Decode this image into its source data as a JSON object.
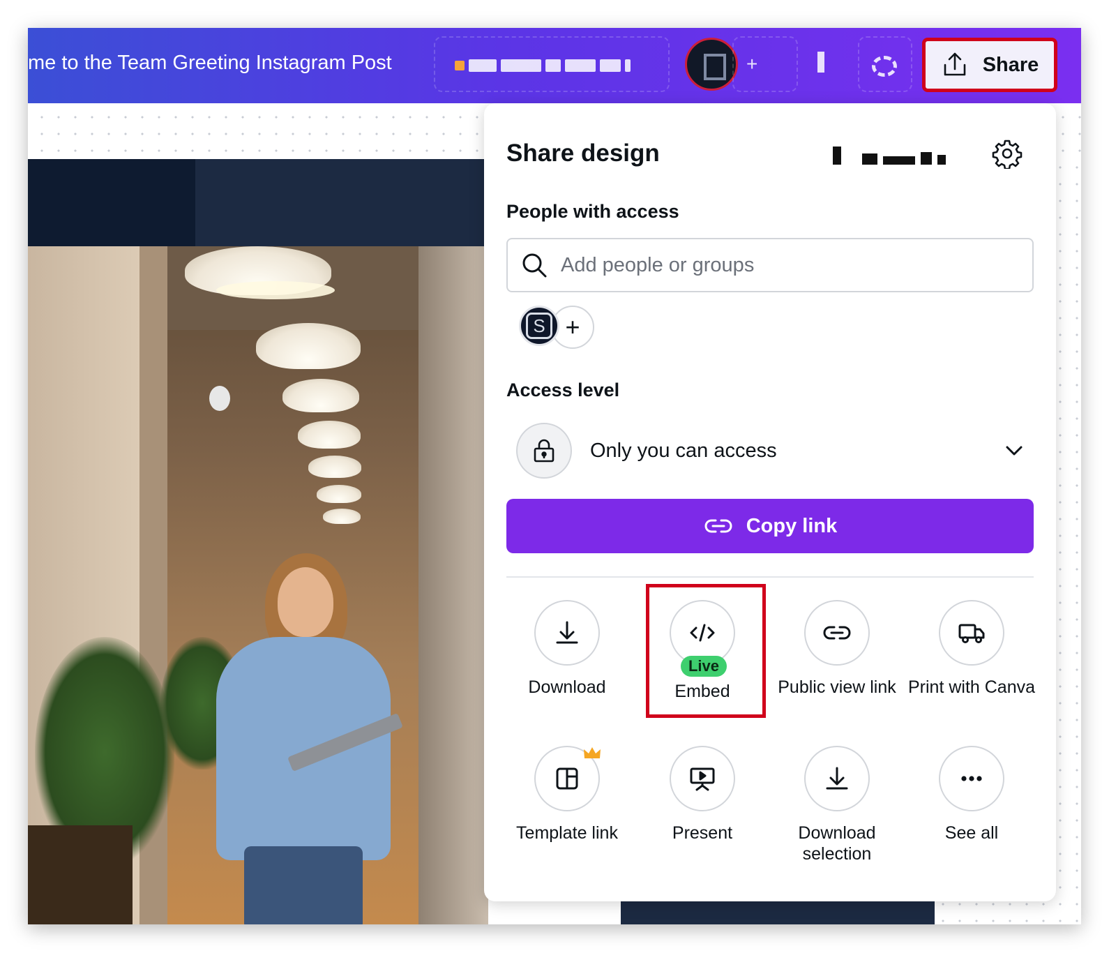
{
  "topbar": {
    "doc_title": "me to the Team Greeting Instagram Post",
    "share_label": "Share"
  },
  "share_panel": {
    "title": "Share design",
    "people_section_label": "People with access",
    "search_placeholder": "Add people or groups",
    "member_initial": "S",
    "add_member_label": "+",
    "access_section_label": "Access level",
    "access_value": "Only you can access",
    "copy_link_label": "Copy link",
    "options": [
      {
        "label": "Download",
        "icon": "download-icon"
      },
      {
        "label": "Embed",
        "icon": "embed-code-icon",
        "badge": "Live"
      },
      {
        "label": "Public view link",
        "icon": "link-icon"
      },
      {
        "label": "Print with Canva",
        "icon": "truck-icon"
      },
      {
        "label": "Template link",
        "icon": "template-icon",
        "premium": true
      },
      {
        "label": "Present",
        "icon": "present-icon"
      },
      {
        "label": "Download selection",
        "icon": "download-icon"
      },
      {
        "label": "See all",
        "icon": "more-icon"
      }
    ]
  },
  "colors": {
    "topbar_start": "#3b4fd6",
    "topbar_end": "#7a2ff0",
    "primary_button": "#7d2ae8",
    "live_badge": "#3ecf6e",
    "highlight": "#d0021b",
    "premium_crown": "#f5a623"
  }
}
